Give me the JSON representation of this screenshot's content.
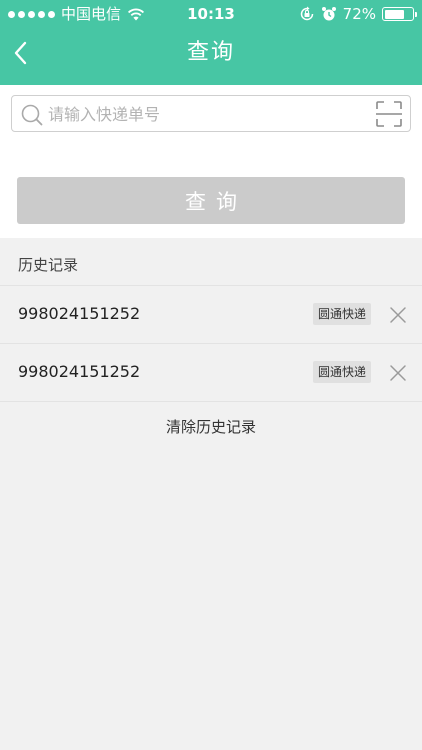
{
  "status_bar": {
    "carrier": "中国电信",
    "time": "10:13",
    "battery_percent": "72%",
    "battery_level": 0.72
  },
  "nav": {
    "title": "查询",
    "back_icon": "chevron-left-icon"
  },
  "search": {
    "placeholder": "请输入快递单号",
    "value": "",
    "scan_icon": "scan-icon"
  },
  "query_button": {
    "label": "查询"
  },
  "history": {
    "title": "历史记录",
    "items": [
      {
        "number": "998024151252",
        "carrier": "圆通快递"
      },
      {
        "number": "998024151252",
        "carrier": "圆通快递"
      }
    ],
    "clear_label": "清除历史记录"
  },
  "colors": {
    "accent": "#47c6a4",
    "button_disabled": "#cbcbcb",
    "background": "#f1f1f1"
  }
}
